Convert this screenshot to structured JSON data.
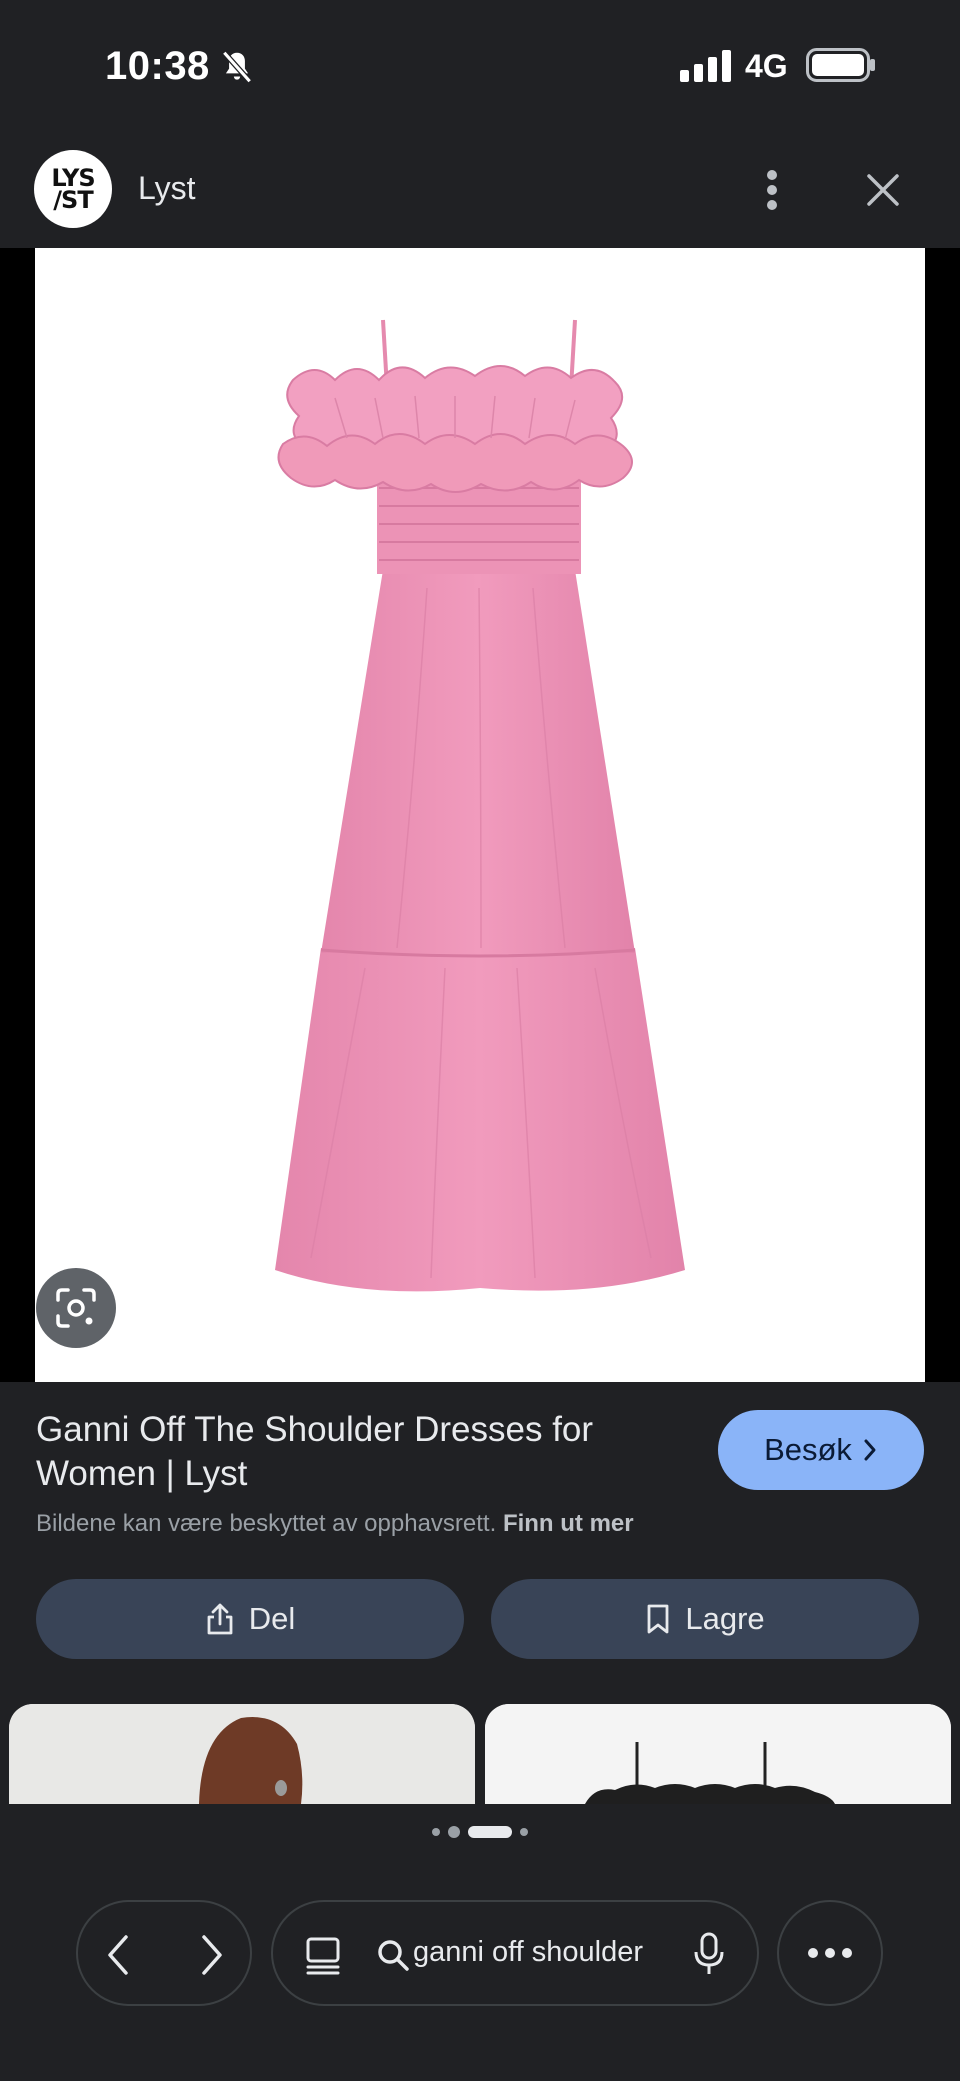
{
  "status_bar": {
    "time": "10:38",
    "network": "4G"
  },
  "header": {
    "site_name": "Lyst",
    "logo_text": "LYS\n/ST"
  },
  "result": {
    "title": "Ganni Off The Shoulder Dresses for Women | Lyst",
    "visit_label": "Besøk",
    "copyright_text": "Bildene kan være beskyttet av opphavsrett.",
    "copyright_link": "Finn ut mer",
    "share_label": "Del",
    "save_label": "Lagre"
  },
  "bottom_bar": {
    "search_query": "ganni off shoulder"
  },
  "colors": {
    "background": "#202124",
    "accent": "#8ab4f8",
    "button": "#394457",
    "dress": "#ee94b8"
  }
}
